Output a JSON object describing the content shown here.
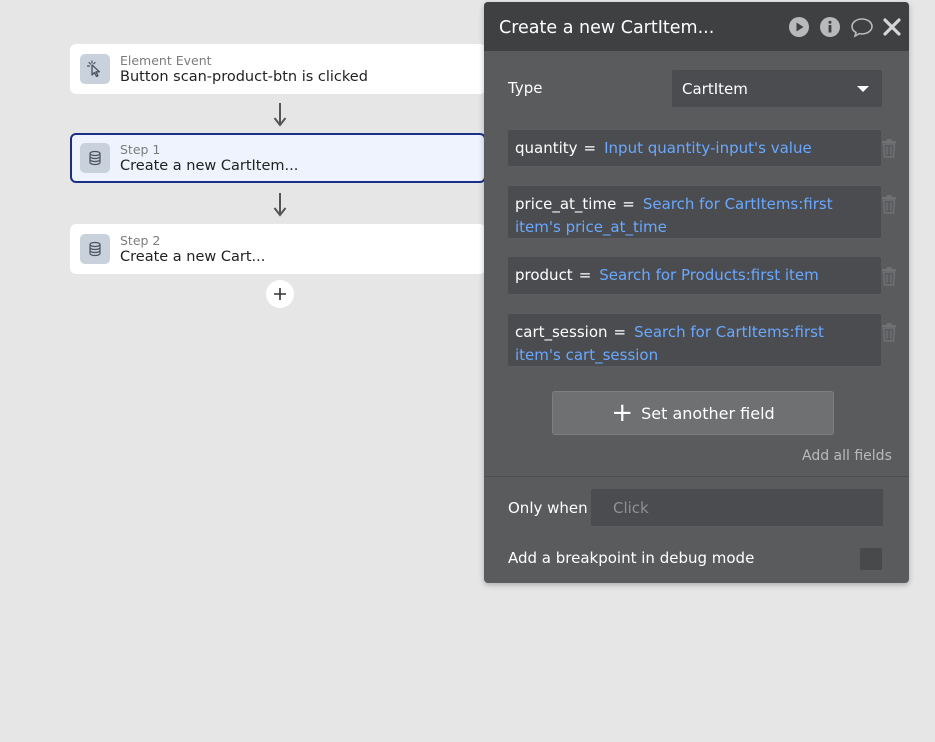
{
  "workflow": {
    "event": {
      "kind": "Element Event",
      "title": "Button scan-product-btn is clicked",
      "icon": "cursor-click-icon"
    },
    "steps": [
      {
        "label": "Step 1",
        "title": "Create a new CartItem...",
        "icon": "database-icon",
        "selected": true
      },
      {
        "label": "Step 2",
        "title": "Create a new Cart...",
        "icon": "database-icon",
        "selected": false
      }
    ],
    "add_step_icon": "plus-icon"
  },
  "panel": {
    "title": "Create a new CartItem...",
    "header_icons": [
      "play-icon",
      "info-icon",
      "comment-icon",
      "close-icon"
    ],
    "type_label": "Type",
    "type_value": "CartItem",
    "equals": "=",
    "fields": [
      {
        "name": "quantity",
        "expr": "Input quantity-input's value"
      },
      {
        "name": "price_at_time",
        "expr": "Search for CartItems:first item's price_at_time"
      },
      {
        "name": "product",
        "expr": "Search for Products:first item"
      },
      {
        "name": "cart_session",
        "expr": "Search for CartItems:first item's cart_session"
      }
    ],
    "set_another_field": "Set another field",
    "add_all_fields": "Add all fields",
    "only_when_label": "Only when",
    "only_when_placeholder": "Click",
    "breakpoint_label": "Add a breakpoint in debug mode",
    "colors": {
      "panel_bg": "#595b5d",
      "header_bg": "#3e4042",
      "expression_blue": "#6aa8ff",
      "selected_border": "#1a2f86"
    }
  }
}
